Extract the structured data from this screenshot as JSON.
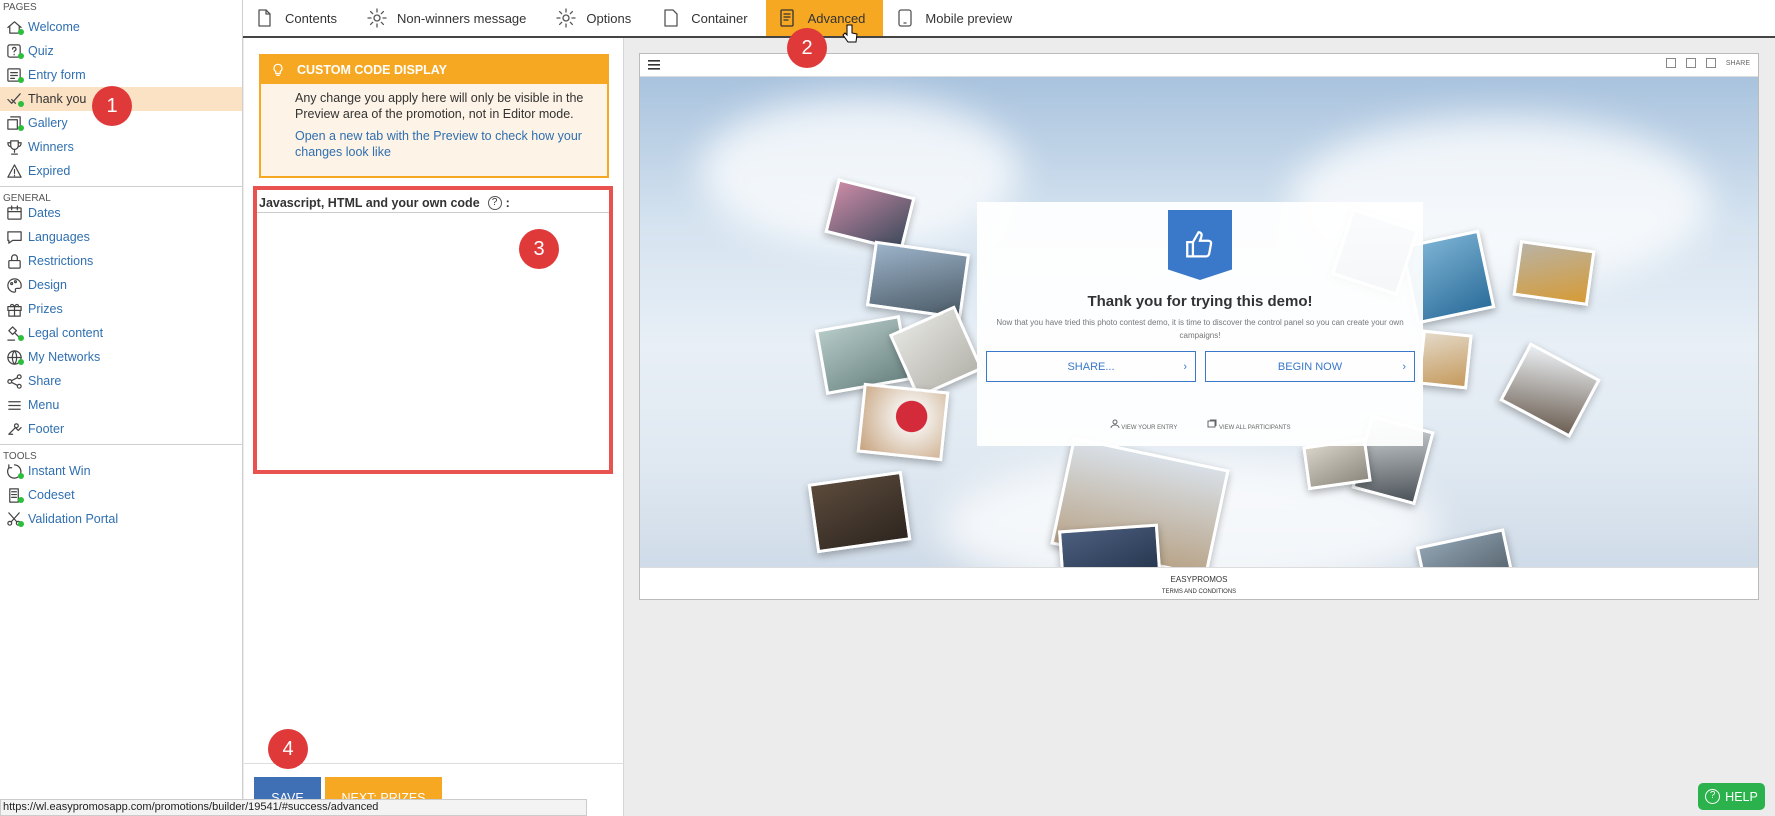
{
  "sidebar": {
    "sections": [
      {
        "title": "PAGES",
        "items": [
          {
            "label": "Welcome",
            "icon": "home-icon",
            "dot": true
          },
          {
            "label": "Quiz",
            "icon": "quiz-icon",
            "dot": true
          },
          {
            "label": "Entry form",
            "icon": "form-icon",
            "dot": true
          },
          {
            "label": "Thank you",
            "icon": "checkmark-icon",
            "dot": true,
            "active": true
          },
          {
            "label": "Gallery",
            "icon": "gallery-icon",
            "dot": true
          },
          {
            "label": "Winners",
            "icon": "trophy-icon",
            "dot": false
          },
          {
            "label": "Expired",
            "icon": "warning-icon",
            "dot": false
          }
        ]
      },
      {
        "title": "GENERAL",
        "items": [
          {
            "label": "Dates",
            "icon": "calendar-icon",
            "dot": false
          },
          {
            "label": "Languages",
            "icon": "speech-bubble-icon",
            "dot": false
          },
          {
            "label": "Restrictions",
            "icon": "lock-icon",
            "dot": false
          },
          {
            "label": "Design",
            "icon": "palette-icon",
            "dot": false
          },
          {
            "label": "Prizes",
            "icon": "gift-icon",
            "dot": false
          },
          {
            "label": "Legal content",
            "icon": "gavel-icon",
            "dot": true
          },
          {
            "label": "My Networks",
            "icon": "globe-icon",
            "dot": true
          },
          {
            "label": "Share",
            "icon": "share-icon",
            "dot": false
          },
          {
            "label": "Menu",
            "icon": "menu-icon",
            "dot": false
          },
          {
            "label": "Footer",
            "icon": "footer-icon",
            "dot": false
          }
        ]
      },
      {
        "title": "TOOLS",
        "items": [
          {
            "label": "Instant Win",
            "icon": "instant-win-icon",
            "dot": true
          },
          {
            "label": "Codeset",
            "icon": "codeset-icon",
            "dot": true
          },
          {
            "label": "Validation Portal",
            "icon": "scissors-icon",
            "dot": true
          }
        ]
      }
    ]
  },
  "tabs": [
    {
      "label": "Contents",
      "icon": "document-icon"
    },
    {
      "label": "Non-winners message",
      "icon": "gear-icon"
    },
    {
      "label": "Options",
      "icon": "gear-icon"
    },
    {
      "label": "Container",
      "icon": "page-icon"
    },
    {
      "label": "Advanced",
      "icon": "code-file-icon",
      "active": true
    },
    {
      "label": "Mobile preview",
      "icon": "tablet-icon"
    }
  ],
  "markers": [
    "1",
    "2",
    "3",
    "4"
  ],
  "notice": {
    "title": "CUSTOM CODE DISPLAY",
    "text": "Any change you apply here will only be visible in the Preview area of the promotion, not in Editor mode.",
    "link": "Open a new tab with the Preview to check how your changes look like"
  },
  "code": {
    "label": "Javascript, HTML and your own code",
    "help": "?",
    "colon": ":",
    "value": ""
  },
  "buttons": {
    "save": "SAVE",
    "next": "NEXT: PRIZES"
  },
  "preview": {
    "share_top": "SHARE",
    "title": "Thank you for trying this demo!",
    "subtitle": "Now that you have tried this photo contest demo, it is time to discover the control panel so you can create your own campaigns!",
    "share_btn": "SHARE...",
    "begin_btn": "BEGIN NOW",
    "view_entry": "VIEW YOUR ENTRY",
    "view_all": "VIEW ALL PARTICIPANTS",
    "footer_brand": "EASYPROMOS",
    "footer_terms": "TERMS AND CONDITIONS"
  },
  "status_url": "https://wl.easypromosapp.com/promotions/builder/19541/#success/advanced",
  "help": "HELP",
  "colors": {
    "accent": "#f7a823",
    "link": "#2f6fb0",
    "marker": "#e0393a",
    "save": "#3f6fb5",
    "help": "#2bb24c"
  }
}
